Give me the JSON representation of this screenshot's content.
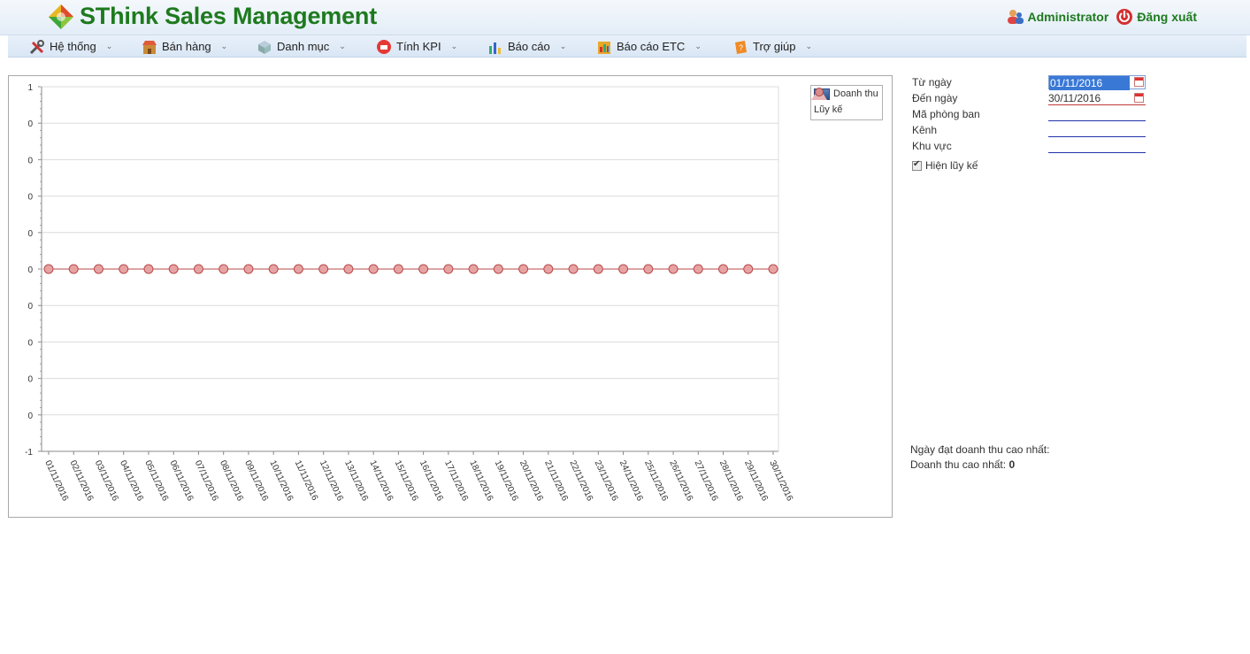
{
  "app": {
    "title": "SThink Sales Management"
  },
  "user": {
    "name": "Administrator",
    "logout_label": "Đăng xuất"
  },
  "menu": [
    {
      "label": "Hệ thống",
      "icon": "tools-icon"
    },
    {
      "label": "Bán hàng",
      "icon": "shop-icon"
    },
    {
      "label": "Danh mục",
      "icon": "catalog-icon"
    },
    {
      "label": "Tính KPI",
      "icon": "kpi-icon"
    },
    {
      "label": "Báo cáo",
      "icon": "report-icon"
    },
    {
      "label": "Báo cáo ETC",
      "icon": "report-etc-icon"
    },
    {
      "label": "Trợ giúp",
      "icon": "help-icon"
    }
  ],
  "filters": {
    "from_label": "Từ ngày",
    "from_value": "01/11/2016",
    "to_label": "Đến ngày",
    "to_value": "30/11/2016",
    "dept_label": "Mã phòng ban",
    "dept_value": "",
    "channel_label": "Kênh",
    "channel_value": "",
    "region_label": "Khu vực",
    "region_value": "",
    "cumulative_label": "Hiện lũy kế",
    "cumulative_checked": true
  },
  "summary": {
    "max_date_label": "Ngày đạt doanh thu cao nhất:",
    "max_date_value": "",
    "max_revenue_label": "Doanh thu cao nhất:",
    "max_revenue_value": "0"
  },
  "colors": {
    "brand": "#1e7a1e",
    "bar": "#2e4f8a",
    "line": "#b94a4a",
    "marker": "#e7a3a3"
  },
  "chart_data": {
    "type": "line",
    "title": "",
    "xlabel": "",
    "ylabel": "",
    "ylim": [
      -1,
      1
    ],
    "y_tick_labels": [
      "1",
      "0",
      "0",
      "0",
      "0",
      "0",
      "0",
      "0",
      "0",
      "0",
      "-1"
    ],
    "grid": true,
    "legend_position": "top-right",
    "categories": [
      "01/11/2016",
      "02/11/2016",
      "03/11/2016",
      "04/11/2016",
      "05/11/2016",
      "06/11/2016",
      "07/11/2016",
      "08/11/2016",
      "09/11/2016",
      "10/11/2016",
      "11/11/2016",
      "12/11/2016",
      "13/11/2016",
      "14/11/2016",
      "15/11/2016",
      "16/11/2016",
      "17/11/2016",
      "18/11/2016",
      "19/11/2016",
      "20/11/2016",
      "21/11/2016",
      "22/11/2016",
      "23/11/2016",
      "24/11/2016",
      "25/11/2016",
      "26/11/2016",
      "27/11/2016",
      "28/11/2016",
      "29/11/2016",
      "30/11/2016"
    ],
    "series": [
      {
        "name": "Doanh thu",
        "type": "bar",
        "values": [
          0,
          0,
          0,
          0,
          0,
          0,
          0,
          0,
          0,
          0,
          0,
          0,
          0,
          0,
          0,
          0,
          0,
          0,
          0,
          0,
          0,
          0,
          0,
          0,
          0,
          0,
          0,
          0,
          0,
          0
        ]
      },
      {
        "name": "Lũy kế",
        "type": "line",
        "values": [
          0,
          0,
          0,
          0,
          0,
          0,
          0,
          0,
          0,
          0,
          0,
          0,
          0,
          0,
          0,
          0,
          0,
          0,
          0,
          0,
          0,
          0,
          0,
          0,
          0,
          0,
          0,
          0,
          0,
          0
        ]
      }
    ]
  }
}
